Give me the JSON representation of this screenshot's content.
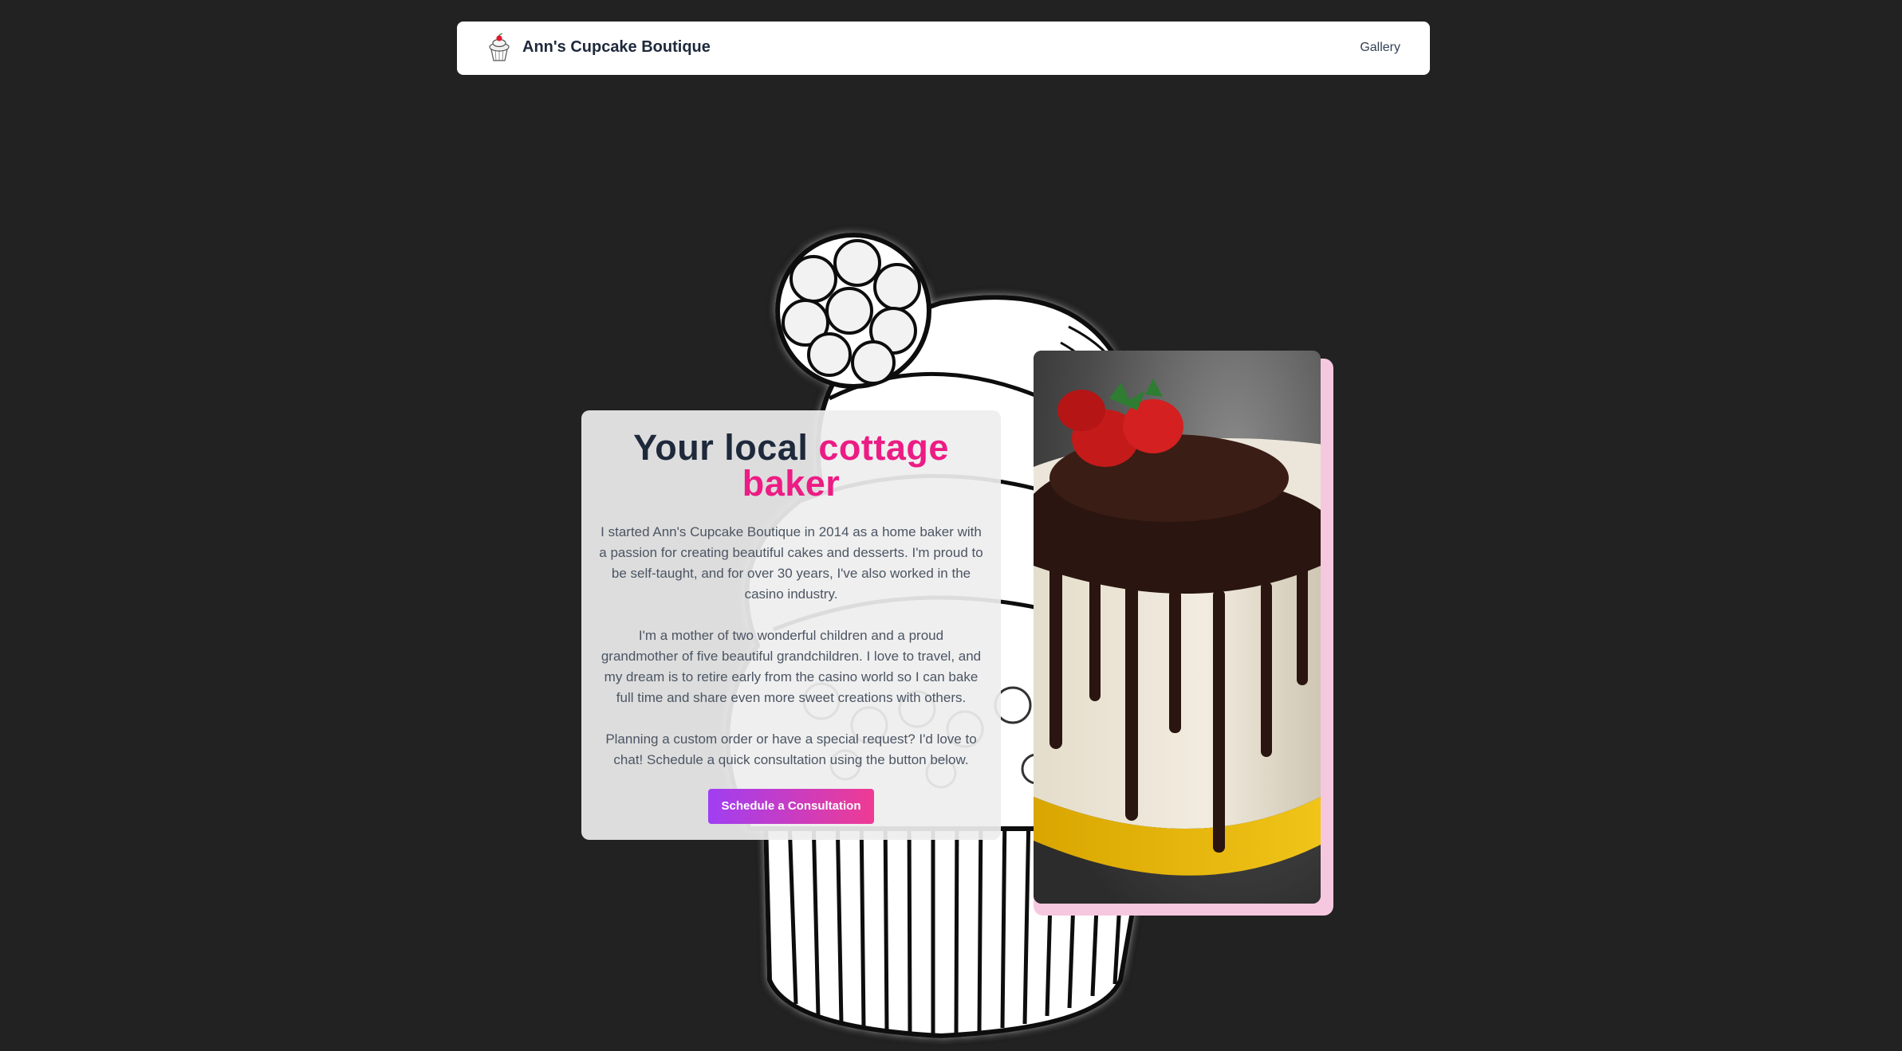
{
  "nav": {
    "brand_name": "Ann's Cupcake Boutique",
    "logo_icon": "cupcake-logo-icon",
    "links": [
      {
        "label": "Gallery"
      }
    ]
  },
  "hero": {
    "headline_part1": "Your local",
    "headline_accent": "cottage baker",
    "paragraphs": [
      "I started Ann's Cupcake Boutique in 2014 as a home baker with a passion for creating beautiful cakes and desserts. I'm proud to be self-taught, and for over 30 years, I've also worked in the casino industry.",
      "I'm a mother of two wonderful children and a proud grandmother of five beautiful grandchildren. I love to travel, and my dream is to retire early from the casino world so I can bake full time and share even more sweet creations with others.",
      "Planning a custom order or have a special request? I'd love to chat! Schedule a quick consultation using the button below."
    ],
    "cta_label": "Schedule a Consultation"
  },
  "images": {
    "background": "cupcake-illustration",
    "photo": "chocolate-drip-strawberry-cake"
  },
  "colors": {
    "page_bg": "#222222",
    "accent_pink": "#ec1c84",
    "heading": "#1e293b",
    "cta_gradient_start": "#a03ef2",
    "cta_gradient_end": "#ef3b93",
    "photo_frame": "#f6c8df"
  }
}
